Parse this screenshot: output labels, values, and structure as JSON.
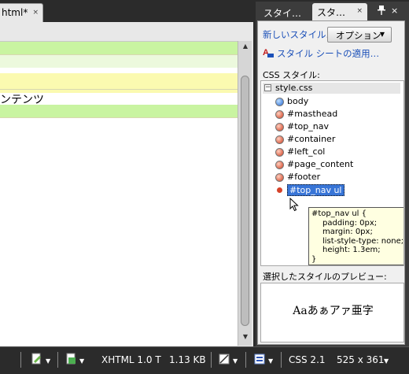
{
  "editor": {
    "tab_label": "html*",
    "tab_close": "×",
    "doc_text": "ンテンツ",
    "scroll_up": "▲",
    "scroll_down": "▼"
  },
  "panel": {
    "tab_inactive": "スタイ…",
    "tab_active": "スタ…",
    "tab_close": "×",
    "pin": "📌",
    "close": "×",
    "new_style_link": "新しいスタイル…",
    "options_label": "オプション",
    "apply_sheet_link": "スタイル シートの適用…",
    "css_styles_label": "CSS スタイル:",
    "tree": {
      "root": "style.css",
      "items": [
        {
          "label": "body"
        },
        {
          "label": "#masthead"
        },
        {
          "label": "#top_nav"
        },
        {
          "label": "#container"
        },
        {
          "label": "#left_col"
        },
        {
          "label": "#page_content"
        },
        {
          "label": "#footer"
        },
        {
          "label": "#top_nav ul"
        }
      ]
    },
    "tooltip_lines": [
      "#top_nav ul {",
      "padding: 0px;",
      "margin: 0px;",
      "list-style-type: none;",
      "height: 1.3em;",
      "}"
    ],
    "preview_label": "選択したスタイルのプレビュー:",
    "preview_sample": "Aaあぁアァ亜字"
  },
  "statusbar": {
    "doctype": "XHTML 1.0 T",
    "size": "1.13 KB",
    "css_version": "CSS 2.1",
    "dimensions": "525 x 361"
  }
}
